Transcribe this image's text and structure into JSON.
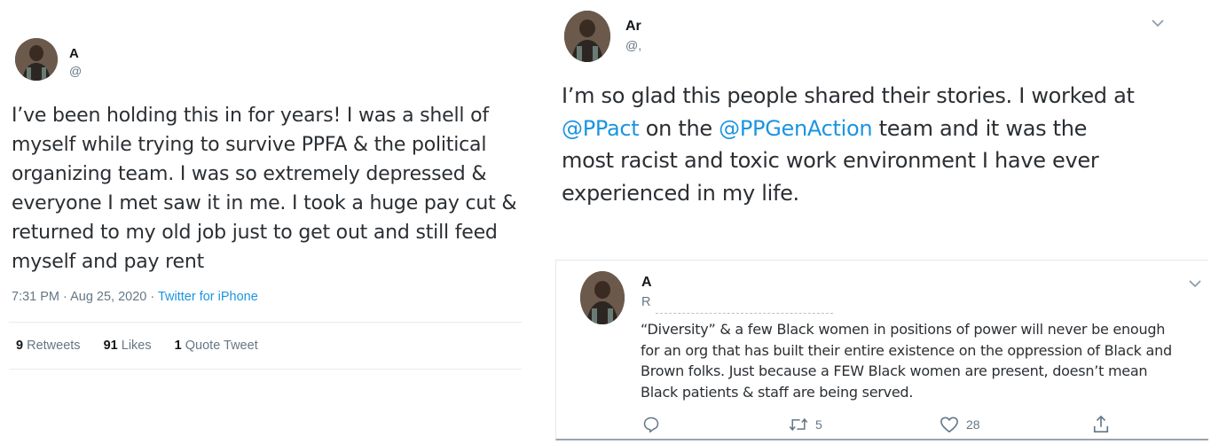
{
  "left_tweet": {
    "name": "A",
    "handle": "@",
    "body_lines": [
      "I’ve been holding this in for years! I was a shell of",
      "myself while trying to survive PPFA & the political",
      "organizing team. I was so extremely depressed &",
      "everyone I met saw it in me. I took a huge pay cut &",
      "returned to my old job just to get out and still feed",
      "myself and pay rent"
    ],
    "time": "7:31 PM · Aug 25, 2020 · ",
    "source": "Twitter for iPhone",
    "stats": {
      "retweets_count": "9",
      "retweets_label": "Retweets",
      "likes_count": "91",
      "likes_label": "Likes",
      "quotes_count": "1",
      "quotes_label": "Quote Tweet"
    }
  },
  "right_tweet": {
    "name": "Ar",
    "handle": "@,",
    "body": {
      "line1": "I’m so glad this people shared their stories. I worked at",
      "mention1": "@PPact",
      "line2_mid": " on the ",
      "mention2": "@PPGenAction",
      "line2_end": " team and it was the",
      "line3": "most racist and toxic work environment I have ever",
      "line4": "experienced in my life."
    }
  },
  "reply_tweet": {
    "name": "A",
    "handle": "R",
    "body_lines": [
      "“Diversity” & a few Black women in positions of power will never be enough",
      "for an org that has built their entire existence on the oppression of Black and",
      "Brown folks. Just because a FEW Black women are present, doesn’t mean",
      "Black patients & staff are being served."
    ],
    "actions": {
      "reply_icon": "reply-icon",
      "retweet_icon": "retweet-icon",
      "retweet_count": "5",
      "like_icon": "heart-icon",
      "like_count": "28",
      "share_icon": "share-icon"
    }
  },
  "colors": {
    "link": "#1b95e0",
    "secondary_text": "#657786",
    "primary_text": "#14171a"
  }
}
